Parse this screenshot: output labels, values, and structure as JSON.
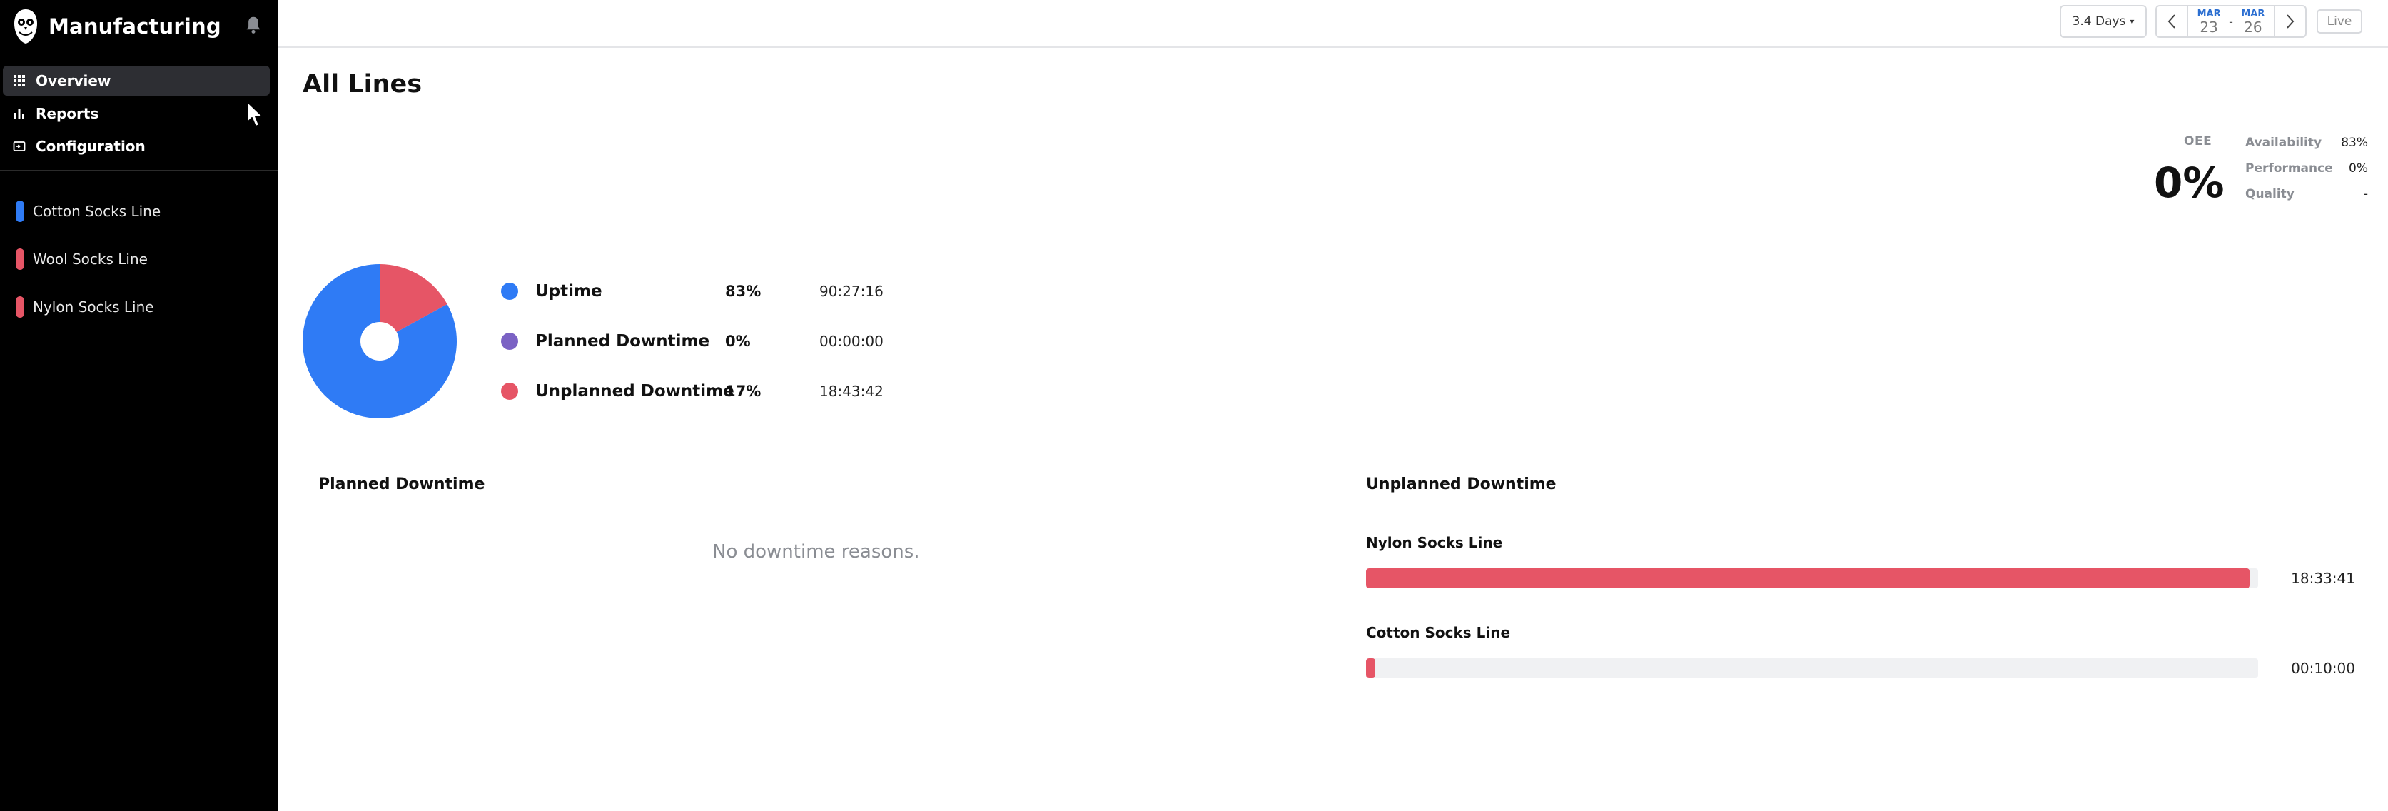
{
  "app": {
    "title": "Manufacturing"
  },
  "sidebar": {
    "nav": [
      {
        "label": "Overview",
        "icon": "grid-icon",
        "active": true
      },
      {
        "label": "Reports",
        "icon": "bar-chart-icon",
        "active": false
      },
      {
        "label": "Configuration",
        "icon": "config-icon",
        "active": false
      }
    ],
    "lines": [
      {
        "label": "Cotton Socks Line",
        "color": "#2f7bf5"
      },
      {
        "label": "Wool Socks Line",
        "color": "#e65566"
      },
      {
        "label": "Nylon Socks Line",
        "color": "#e65566"
      }
    ]
  },
  "topbar": {
    "range_label": "3.4 Days",
    "start": {
      "month": "MAR",
      "day": "23"
    },
    "end": {
      "month": "MAR",
      "day": "26"
    },
    "separator": "-",
    "live_label": "Live"
  },
  "main": {
    "title": "All Lines"
  },
  "oee": {
    "label": "OEE",
    "value": "0%",
    "metrics": [
      {
        "label": "Availability",
        "value": "83%"
      },
      {
        "label": "Performance",
        "value": "0%"
      },
      {
        "label": "Quality",
        "value": "-"
      }
    ]
  },
  "chart_data": {
    "type": "pie",
    "categories": [
      "Uptime",
      "Planned Downtime",
      "Unplanned Downtime"
    ],
    "values": [
      83,
      0,
      17
    ],
    "colors": [
      "#2f7bf5",
      "#7b62c4",
      "#e65566"
    ],
    "durations": [
      "90:27:16",
      "00:00:00",
      "18:43:42"
    ],
    "value_labels": [
      "83%",
      "0%",
      "17%"
    ]
  },
  "planned_downtime": {
    "title": "Planned Downtime",
    "empty_text": "No downtime reasons."
  },
  "unplanned_downtime": {
    "title": "Unplanned Downtime",
    "items": [
      {
        "line": "Nylon Socks Line",
        "duration": "18:33:41",
        "fraction": 0.99
      },
      {
        "line": "Cotton Socks Line",
        "duration": "00:10:00",
        "fraction": 0.009
      }
    ]
  }
}
